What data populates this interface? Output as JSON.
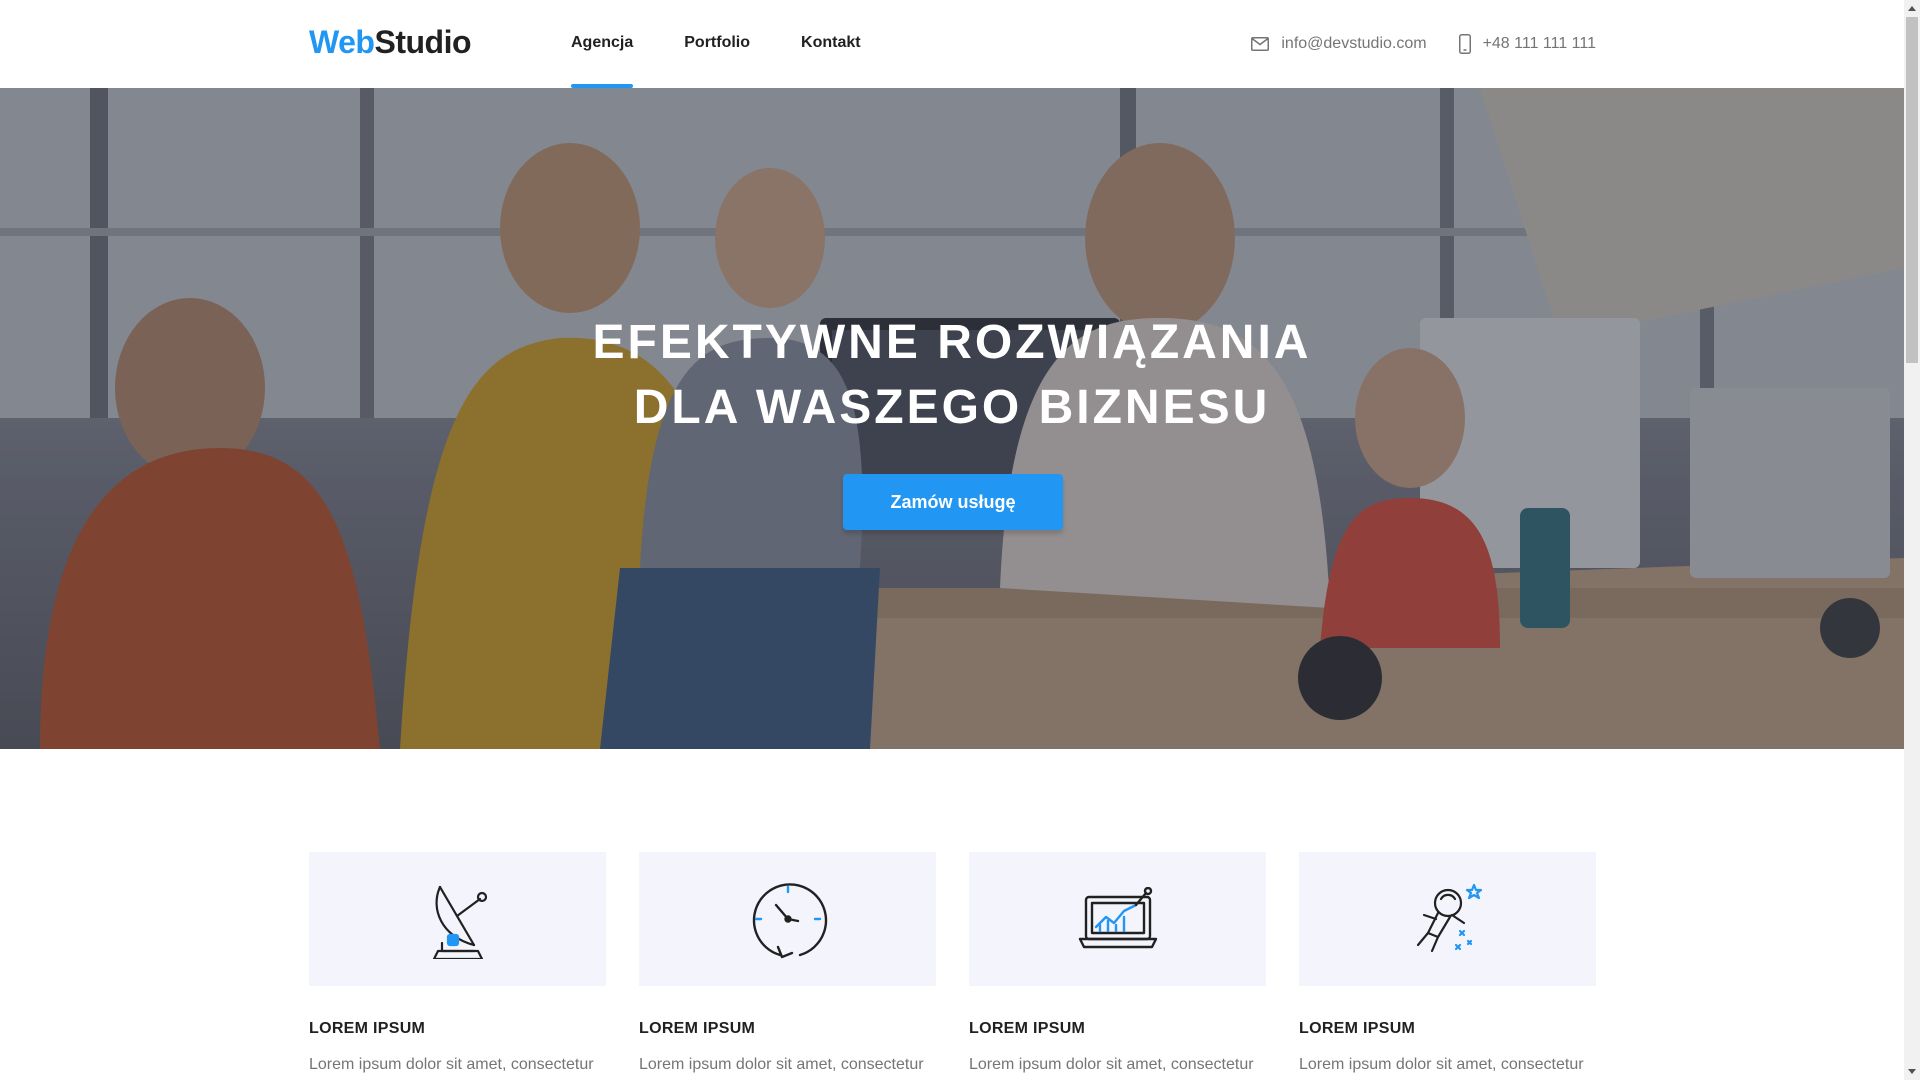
{
  "header": {
    "logo_part1": "Web",
    "logo_part2": "Studio",
    "nav": [
      {
        "label": "Agencja",
        "active": true
      },
      {
        "label": "Portfolio",
        "active": false
      },
      {
        "label": "Kontakt",
        "active": false
      }
    ],
    "email": "info@devstudio.com",
    "phone": "+48 111 111 111"
  },
  "hero": {
    "title_line1": "EFEKTYWNE ROZWIĄZANIA",
    "title_line2": "DLA WASZEGO BIZNESU",
    "button": "Zamów usługę"
  },
  "features": [
    {
      "icon": "satellite-dish-icon",
      "title": "LOREM IPSUM",
      "text": "Lorem ipsum dolor sit amet, consectetur"
    },
    {
      "icon": "clock-icon",
      "title": "LOREM IPSUM",
      "text": "Lorem ipsum dolor sit amet, consectetur"
    },
    {
      "icon": "laptop-chart-icon",
      "title": "LOREM IPSUM",
      "text": "Lorem ipsum dolor sit amet, consectetur"
    },
    {
      "icon": "astronaut-icon",
      "title": "LOREM IPSUM",
      "text": "Lorem ipsum dolor sit amet, consectetur"
    }
  ],
  "colors": {
    "accent": "#2196f3",
    "text": "#212121",
    "muted": "#757575",
    "card_bg": "#f4f4fd"
  }
}
